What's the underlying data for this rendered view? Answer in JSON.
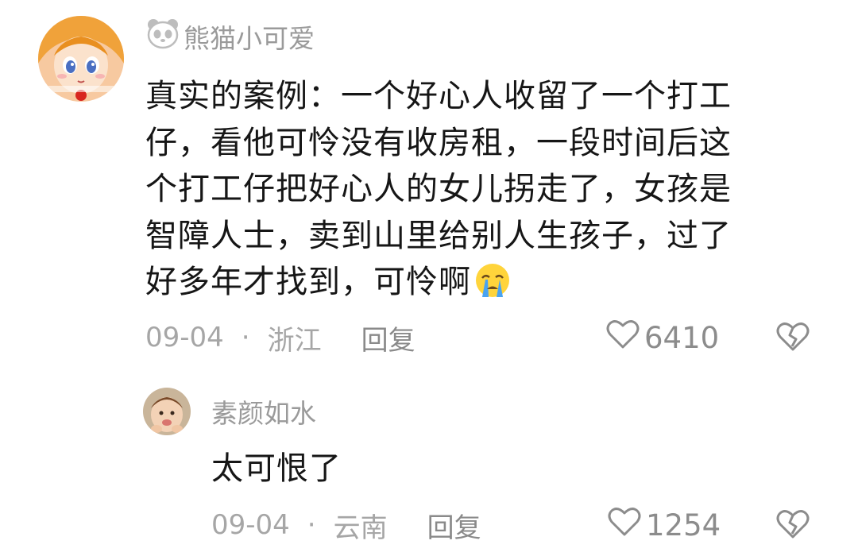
{
  "comments": [
    {
      "username": "熊猫小可爱",
      "badge_icon": "panda-icon",
      "avatar_icon": "anime-girl-avatar",
      "lines": [
        "真实的案例：一个好心人收留了一个打工",
        "仔，看他可怜没有收房租，一段时间后这",
        "个打工仔把好心人的女儿拐走了，女孩是",
        "智障人士，卖到山里给别人生孩子，过了",
        "好多年才找到，可怜啊"
      ],
      "trailing_emoji": "crying-face-emoji",
      "date": "09-04",
      "separator": "·",
      "location": "浙江",
      "reply_label": "回复",
      "likes": "6410",
      "like_icon": "heart-outline-icon",
      "dislike_icon": "broken-heart-icon"
    },
    {
      "username": "素颜如水",
      "avatar_icon": "baby-photo-avatar",
      "lines": [
        "太可恨了"
      ],
      "date": "09-04",
      "separator": "·",
      "location": "云南",
      "reply_label": "回复",
      "likes": "1254",
      "like_icon": "heart-outline-icon",
      "dislike_icon": "broken-heart-icon"
    }
  ],
  "colors": {
    "text": "#161616",
    "muted": "#9a9a9a",
    "icon": "#8c8c8c"
  }
}
